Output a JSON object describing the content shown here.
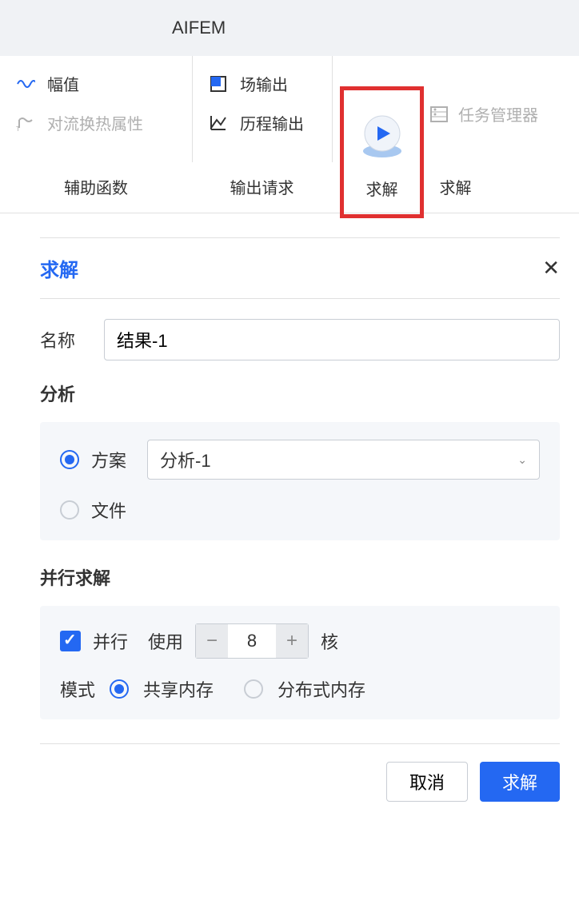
{
  "app": {
    "title": "AIFEM"
  },
  "ribbon": {
    "items": {
      "amplitude": "幅值",
      "convection": "对流换热属性",
      "field_output": "场输出",
      "history_output": "历程输出",
      "solve": "求解",
      "task_manager": "任务管理器"
    },
    "groups": {
      "helpers": "辅助函数",
      "output_request": "输出请求",
      "solve": "求解"
    }
  },
  "dialog": {
    "title": "求解",
    "name_label": "名称",
    "name_value": "结果-1",
    "analysis_section": "分析",
    "scheme_label": "方案",
    "scheme_value": "分析-1",
    "file_label": "文件",
    "parallel_section": "并行求解",
    "parallel_label": "并行",
    "use_label": "使用",
    "cores_value": "8",
    "cores_label": "核",
    "mode_label": "模式",
    "shared_mem": "共享内存",
    "distributed_mem": "分布式内存",
    "cancel": "取消",
    "solve": "求解"
  }
}
